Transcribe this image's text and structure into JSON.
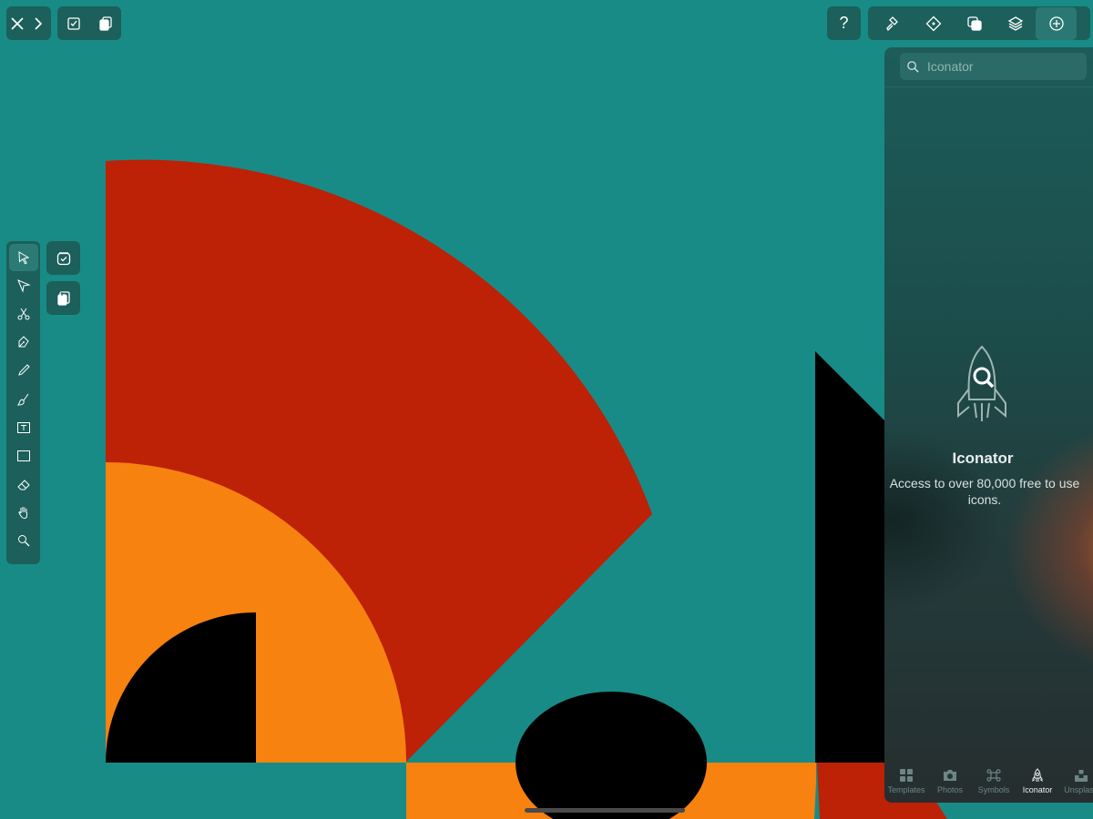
{
  "app": {
    "accent_color": "#188b86",
    "toolbar_color": "#1c5f5b"
  },
  "top_left": {
    "close_icon": "close-icon",
    "forward_icon": "chevron-right-icon",
    "checkbox_icon": "checkbox-icon",
    "duplicate_icon": "duplicate-icon"
  },
  "top_right": {
    "help_label": "?",
    "buttons": [
      {
        "name": "hammer-icon"
      },
      {
        "name": "diamond-icon"
      },
      {
        "name": "shapes-icon"
      },
      {
        "name": "layers-icon"
      },
      {
        "name": "add-circle-icon"
      }
    ]
  },
  "left_tools": {
    "items": [
      {
        "name": "select-tool"
      },
      {
        "name": "direct-select-tool"
      },
      {
        "name": "scissors-tool"
      },
      {
        "name": "pen-tool"
      },
      {
        "name": "pencil-tool"
      },
      {
        "name": "brush-tool"
      },
      {
        "name": "text-tool"
      },
      {
        "name": "rectangle-tool"
      },
      {
        "name": "eraser-tool"
      },
      {
        "name": "hand-tool"
      },
      {
        "name": "zoom-tool"
      }
    ]
  },
  "panel": {
    "search": {
      "placeholder": "Iconator"
    },
    "hero": {
      "title": "Iconator",
      "description": "Access to over 80,000 free to use icons."
    },
    "tabs": [
      {
        "label": "Templates"
      },
      {
        "label": "Photos"
      },
      {
        "label": "Symbols"
      },
      {
        "label": "Iconator"
      },
      {
        "label": "Unsplash"
      }
    ]
  },
  "artwork_colors": {
    "red": "#bd2106",
    "orange": "#f7820f",
    "black": "#000000",
    "teal": "#188b86"
  }
}
